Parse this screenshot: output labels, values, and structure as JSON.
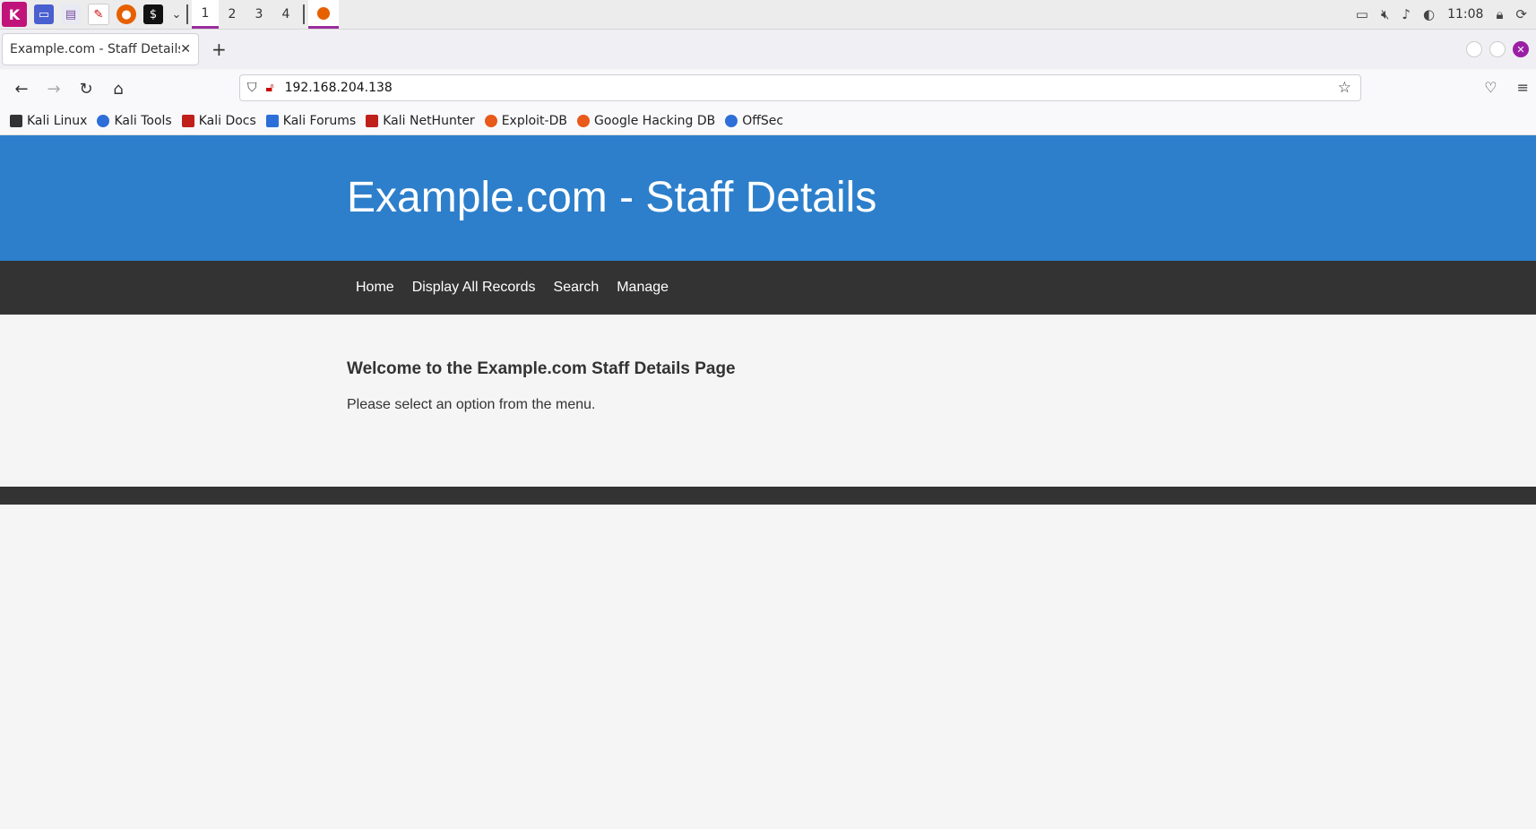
{
  "taskbar": {
    "workspaces": [
      "1",
      "2",
      "3",
      "4"
    ],
    "clock": "11:08"
  },
  "browser": {
    "tab_title": "Example.com - Staff Details",
    "url": "192.168.204.138",
    "bookmarks": [
      {
        "label": "Kali Linux",
        "color": "#333333"
      },
      {
        "label": "Kali Tools",
        "color": "#2d6ed8"
      },
      {
        "label": "Kali Docs",
        "color": "#c0201a"
      },
      {
        "label": "Kali Forums",
        "color": "#2d6ed8"
      },
      {
        "label": "Kali NetHunter",
        "color": "#c0201a"
      },
      {
        "label": "Exploit-DB",
        "color": "#e8591a"
      },
      {
        "label": "Google Hacking DB",
        "color": "#e8591a"
      },
      {
        "label": "OffSec",
        "color": "#2d6ed8"
      }
    ]
  },
  "page": {
    "title": "Example.com - Staff Details",
    "nav": [
      "Home",
      "Display All Records",
      "Search",
      "Manage"
    ],
    "welcome_heading": "Welcome to the Example.com Staff Details Page",
    "welcome_text": "Please select an option from the menu.",
    "colors": {
      "header": "#2d7fcb",
      "menu": "#333333"
    }
  }
}
